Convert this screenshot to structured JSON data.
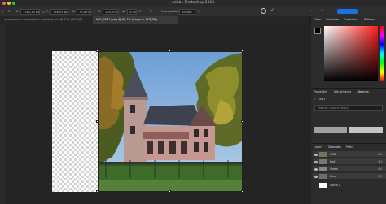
{
  "app": {
    "title": "Adobe Photoshop 2023"
  },
  "options_bar": {
    "x_value": "1181,25 px",
    "y_value": "786,02 px",
    "w_value": "78,82%",
    "h_value": "100,00%",
    "angle_value": "0,00",
    "interpolation_label": "Interpolation:",
    "interpolation_value": "Bicubic"
  },
  "document_tabs": [
    {
      "label": "programok-szamolashoz-nyitokep.psd @ 33% (RGB/8)",
      "active": false
    },
    {
      "label": "IMG_3887.jpeg @ 66,7% (Layer 0, RGB/8*)",
      "active": true
    }
  ],
  "panels": {
    "color_tabs": [
      "Color",
      "Swatches",
      "Gradients",
      "Patterns"
    ],
    "props_tabs": [
      "Properties",
      "Adjustments",
      "Libraries"
    ],
    "library_name": "TEXT",
    "library_search_placeholder": "Search current library",
    "layers_tabs": [
      "Layers",
      "Channels",
      "Paths"
    ],
    "channels": [
      {
        "name": "RGB",
        "shortcut": "⌘2"
      },
      {
        "name": "Red",
        "shortcut": "⌘3"
      },
      {
        "name": "Green",
        "shortcut": "⌘4"
      },
      {
        "name": "Blue",
        "shortcut": "⌘5"
      },
      {
        "name": "Alpha 1",
        "shortcut": ""
      }
    ]
  },
  "colors": {
    "accent": "#1473e6",
    "foreground": "#000000",
    "background": "#ffffff"
  }
}
